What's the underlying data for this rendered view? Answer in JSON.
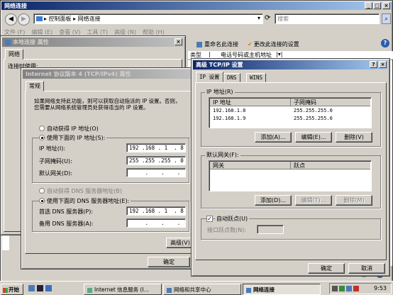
{
  "explorer": {
    "title": "网络连接",
    "address_path": "▸ 控制面板 ▸ 网络连接",
    "search_placeholder": "搜索",
    "menu": [
      "文件 (F)",
      "编辑 (E)",
      "查看 (V)",
      "工具 (T)",
      "高级 (N)",
      "帮助 (H)"
    ],
    "toolbar": {
      "rename": "重命名此连接",
      "change_settings": "更改此连接的设置"
    },
    "columns": {
      "type": "类型",
      "phone": "电话号码或主机地址"
    }
  },
  "local_conn": {
    "title": "本地连接 属性",
    "tab": "网络",
    "connect_label": "连接时使用:"
  },
  "ipv4": {
    "title": "Internet 协议版本 4 (TCP/IPv4) 属性",
    "tab": "常规",
    "desc_line1": "如果网络支持此功能，则可以获取自动指派的 IP 设置。否则，",
    "desc_line2": "您需要从网络系统管理员处获得适当的 IP 设置。",
    "auto_ip": "自动获得 IP 地址(O)",
    "manual_ip": "使用下面的 IP 地址(S):",
    "ip_label": "IP 地址(I):",
    "ip_value": "192 .168 . 1  . 8",
    "mask_label": "子网掩码(U):",
    "mask_value": "255 .255 .255 . 0",
    "gw_label": "默认网关(D):",
    "gw_value": "     .    .    .",
    "auto_dns": "自动获得 DNS 服务器地址(B)",
    "manual_dns": "使用下面的 DNS 服务器地址(E):",
    "dns1_label": "首选 DNS 服务器(P):",
    "dns1_value": "192 .168 . 1  . 8",
    "dns2_label": "备用 DNS 服务器(A):",
    "dns2_value": "     .    .    .",
    "advanced_button": "高级(V)",
    "ok_button": "确定"
  },
  "advanced": {
    "title": "高级 TCP/IP 设置",
    "tabs": [
      "IP 设置",
      "DNS",
      "WINS"
    ],
    "ip_group": "IP 地址(R)",
    "ip_columns": [
      "IP 地址",
      "子网掩码"
    ],
    "ip_rows": [
      [
        "192.168.1.8",
        "255.255.255.0"
      ],
      [
        "192.168.1.9",
        "255.255.255.0"
      ]
    ],
    "add_button": "添加(A)...",
    "edit_button": "编辑(E)...",
    "delete_button": "删除(V)",
    "gw_group": "默认网关(F):",
    "gw_columns": [
      "网关",
      "跃点"
    ],
    "gw_add_button": "添加(D)...",
    "gw_edit_button": "编辑(T)...",
    "gw_delete_button": "删除(M)",
    "auto_metric": "自动跃点(U)",
    "interface_metric": "接口跃点数(N):",
    "ok_button": "确定",
    "cancel_button": "取消"
  },
  "taskbar": {
    "start": "开始",
    "tasks": [
      "Internet 信息服务 (I...",
      "网络和共享中心",
      "网络连接"
    ],
    "time": "9:53"
  },
  "colors": {
    "title_active": "#0a246a",
    "title_inactive": "#808080",
    "face": "#d4d0c8",
    "highlight": "#0a246a"
  }
}
